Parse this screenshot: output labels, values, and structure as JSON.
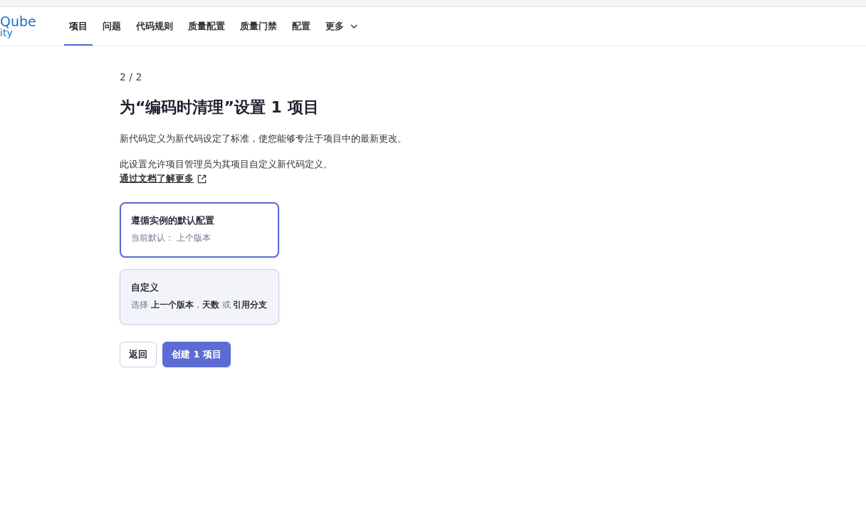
{
  "logo": {
    "name": "Qube",
    "subtitle": "ity"
  },
  "nav": [
    {
      "label": "项目",
      "selected": true,
      "kind": "link"
    },
    {
      "label": "问题",
      "selected": false,
      "kind": "link"
    },
    {
      "label": "代码规则",
      "selected": false,
      "kind": "link"
    },
    {
      "label": "质量配置",
      "selected": false,
      "kind": "link"
    },
    {
      "label": "质量门禁",
      "selected": false,
      "kind": "link"
    },
    {
      "label": "配置",
      "selected": false,
      "kind": "link"
    },
    {
      "label": "更多",
      "selected": false,
      "kind": "dropdown"
    }
  ],
  "page": {
    "step": "2 / 2",
    "title": "为“编码时清理”设置 1 项目",
    "description": "新代码定义为新代码设定了标准，使您能够专注于项目中的最新更改。",
    "note": "此设置允许项目管理员为其项目自定义新代码定义。",
    "doc_link": "通过文档了解更多"
  },
  "options": [
    {
      "title": "遵循实例的默认配置",
      "detail": "当前默认： 上个版本",
      "selected": true
    },
    {
      "title": "自定义",
      "detail": "选择 **上一个版本**，**天数** 或 **引用分支**",
      "selected": false
    }
  ],
  "buttons": [
    {
      "label": "返回",
      "kind": "secondary"
    },
    {
      "label": "创建 1 项目",
      "kind": "primary"
    }
  ]
}
